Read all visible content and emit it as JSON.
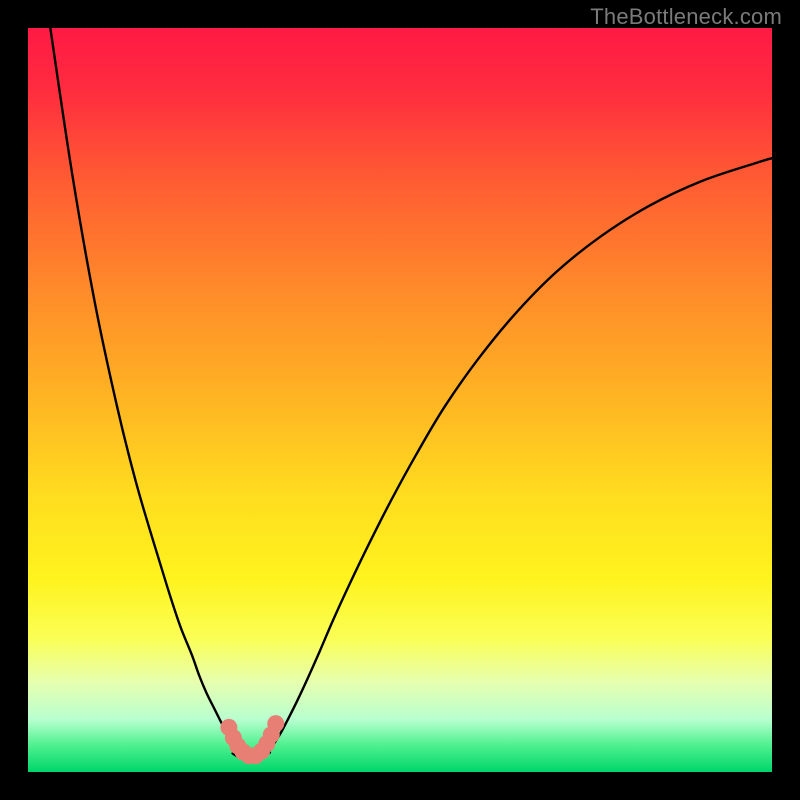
{
  "watermark": "TheBottleneck.com",
  "chart_data": {
    "type": "line",
    "title": "",
    "xlabel": "",
    "ylabel": "",
    "xlim": [
      0,
      100
    ],
    "ylim": [
      0,
      100
    ],
    "background_gradient": {
      "stops": [
        {
          "offset": 0.0,
          "color": "#ff1a44"
        },
        {
          "offset": 0.08,
          "color": "#ff2b3f"
        },
        {
          "offset": 0.2,
          "color": "#ff5a33"
        },
        {
          "offset": 0.35,
          "color": "#ff8a2a"
        },
        {
          "offset": 0.5,
          "color": "#ffb523"
        },
        {
          "offset": 0.63,
          "color": "#ffdd1f"
        },
        {
          "offset": 0.74,
          "color": "#fff31e"
        },
        {
          "offset": 0.82,
          "color": "#fbff55"
        },
        {
          "offset": 0.88,
          "color": "#e6ffb0"
        },
        {
          "offset": 0.93,
          "color": "#b7ffcf"
        },
        {
          "offset": 0.965,
          "color": "#4cf08d"
        },
        {
          "offset": 1.0,
          "color": "#00d66b"
        }
      ]
    },
    "series": [
      {
        "name": "left-branch",
        "x": [
          3,
          6,
          9,
          12,
          14.5,
          17,
          19,
          20.5,
          22,
          23,
          24,
          25,
          25.8,
          26.5,
          27.2,
          27.8,
          28.3
        ],
        "y": [
          100,
          80,
          63,
          49,
          39,
          30.5,
          24,
          19.5,
          15.8,
          13,
          10.6,
          8.6,
          7,
          5.7,
          4.6,
          3.7,
          3.0
        ]
      },
      {
        "name": "right-branch",
        "x": [
          32.5,
          33.2,
          34,
          35,
          36.2,
          37.6,
          39.2,
          41,
          43.2,
          45.8,
          48.8,
          52.2,
          56,
          60.5,
          65.5,
          71,
          77,
          83.5,
          90.5,
          98,
          100
        ],
        "y": [
          3.0,
          4.0,
          5.3,
          7.2,
          9.6,
          12.6,
          16.2,
          20.4,
          25.2,
          30.6,
          36.5,
          42.7,
          49.1,
          55.5,
          61.6,
          67.2,
          72.0,
          76.1,
          79.4,
          81.9,
          82.5
        ]
      },
      {
        "name": "valley-floor",
        "x": [
          27.5,
          28.5,
          29.5,
          30.5,
          31.5,
          32.5
        ],
        "y": [
          2.5,
          1.9,
          1.7,
          1.7,
          2.0,
          2.6
        ]
      }
    ],
    "markers": [
      {
        "x": 27.0,
        "y": 6.0
      },
      {
        "x": 27.6,
        "y": 4.6
      },
      {
        "x": 28.2,
        "y": 3.5
      },
      {
        "x": 28.9,
        "y": 2.7
      },
      {
        "x": 29.7,
        "y": 2.2
      },
      {
        "x": 30.6,
        "y": 2.2
      },
      {
        "x": 31.4,
        "y": 2.8
      },
      {
        "x": 32.1,
        "y": 3.8
      },
      {
        "x": 32.7,
        "y": 5.0
      },
      {
        "x": 33.3,
        "y": 6.5
      }
    ],
    "marker_color": "#e77f74",
    "line_color": "#000000"
  }
}
